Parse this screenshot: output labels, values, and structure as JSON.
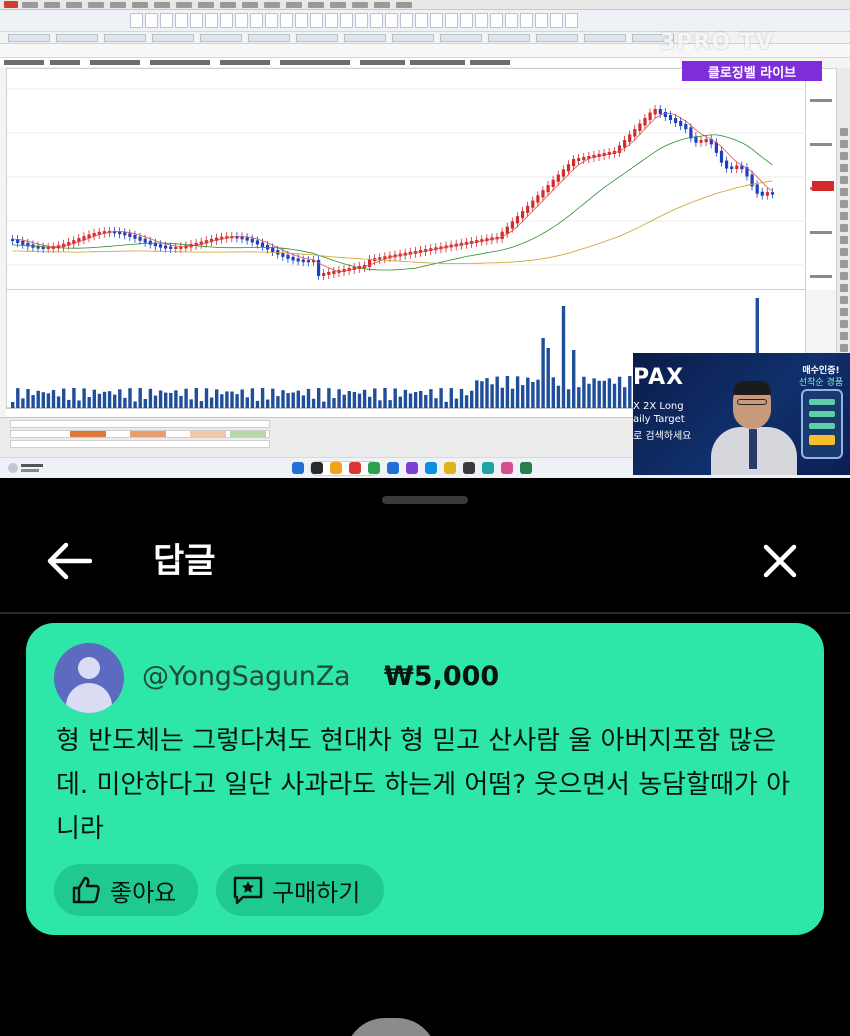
{
  "video": {
    "watermark": "3PRO TV",
    "live_banner": "클로징벨 라이브",
    "presenter_panel": {
      "ad_title": "PAX",
      "ad_line1": "X 2X Long",
      "ad_line2": "aily Target",
      "ad_line3": "로 검색하세요",
      "side_title": "매수인증!",
      "side_sub": "선착순 경품"
    },
    "chart_icons": [
      "candlestick-chart",
      "volume-chart"
    ]
  },
  "sheet": {
    "title": "답글",
    "back_icon": "arrow-left-icon",
    "close_icon": "close-icon"
  },
  "superchat": {
    "background_color": "#2ee6a8",
    "author": "@YongSagunZa",
    "amount": "₩5,000",
    "message": "형 반도체는 그렇다쳐도 현대차 형 믿고 산사람 울 아버지포함 많은데. 미안하다고 일단 사과라도 하는게 어떰? 웃으면서 농담할때가 아니라",
    "like_label": "좋아요",
    "buy_label": "구매하기"
  }
}
